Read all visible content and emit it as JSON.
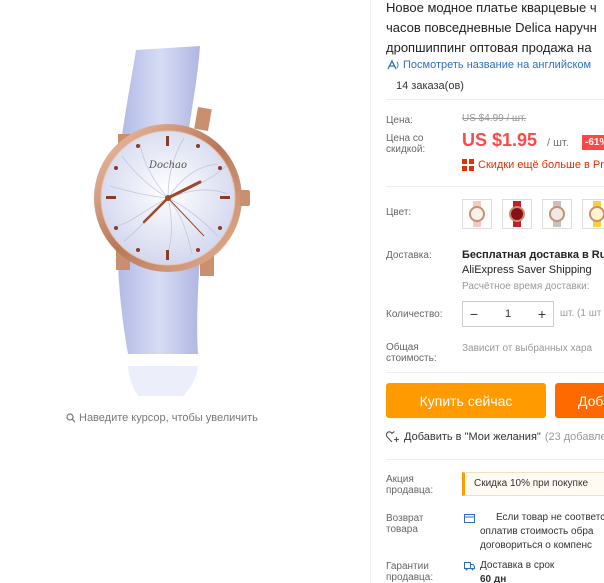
{
  "product": {
    "title_lines": [
      "Новое модное платье кварцевые ч",
      "часов повседневные Delica наручн",
      "дропшиппинг оптовая продажа на"
    ],
    "translate_link": "Посмотреть название на английском",
    "orders": "14 заказа(ов)"
  },
  "gallery": {
    "zoom_hint": "Наведите курсор, чтобы увеличить",
    "watch_brand": "Dochao",
    "strap_color": "#c8cfee",
    "case_color": "#c98f6f"
  },
  "pricing": {
    "price_label": "Цена:",
    "old_price": "US $4.99 / шт.",
    "discount_label_1": "Цена со",
    "discount_label_2": "скидкой:",
    "new_price": "US $1.95",
    "per_unit": "/ шт.",
    "discount_badge": "-61%",
    "more_discounts": "Скидки ещё больше в Pri"
  },
  "color": {
    "label": "Цвет:",
    "swatches": [
      {
        "name": "pink",
        "strap": "#f2c9c4"
      },
      {
        "name": "red",
        "strap": "#c0202a"
      },
      {
        "name": "grey",
        "strap": "#c8c2bb"
      },
      {
        "name": "yellow",
        "strap": "#f5d23a"
      }
    ]
  },
  "shipping": {
    "label": "Доставка:",
    "main": "Бесплатная доставка в Ru",
    "service": "AliExpress Saver Shipping",
    "time": "Расчётное время доставки:"
  },
  "quantity": {
    "label": "Количество:",
    "value": "1",
    "minus": "−",
    "plus": "+",
    "unit_note": "шт. (1 шт"
  },
  "total": {
    "label_1": "Общая",
    "label_2": "стоимость:",
    "note": "Зависит от выбранных хара"
  },
  "actions": {
    "buy_now": "Купить сейчас",
    "add_to_cart": "Доба",
    "wishlist": "Добавить в \"Мои желания\"",
    "wishlist_count": "(23 добавле"
  },
  "seller": {
    "promo_label_1": "Акция",
    "promo_label_2": "продавца:",
    "promo_text": "Скидка 10% при покупке",
    "return_label_1": "Возврат",
    "return_label_2": "товара",
    "return_lines": [
      "Если товар не соответст",
      "оплатив стоимость обра",
      "договориться о компенс"
    ],
    "guarantee_label_1": "Гарантии",
    "guarantee_label_2": "продавца:",
    "guarantee_line": "Доставка в срок",
    "guarantee_days": "60 дн"
  },
  "colors": {
    "price_red": "#ff4747",
    "buy_orange": "#ff9a00",
    "cart_orange": "#ff6a00",
    "link_blue": "#2e6fbd"
  }
}
